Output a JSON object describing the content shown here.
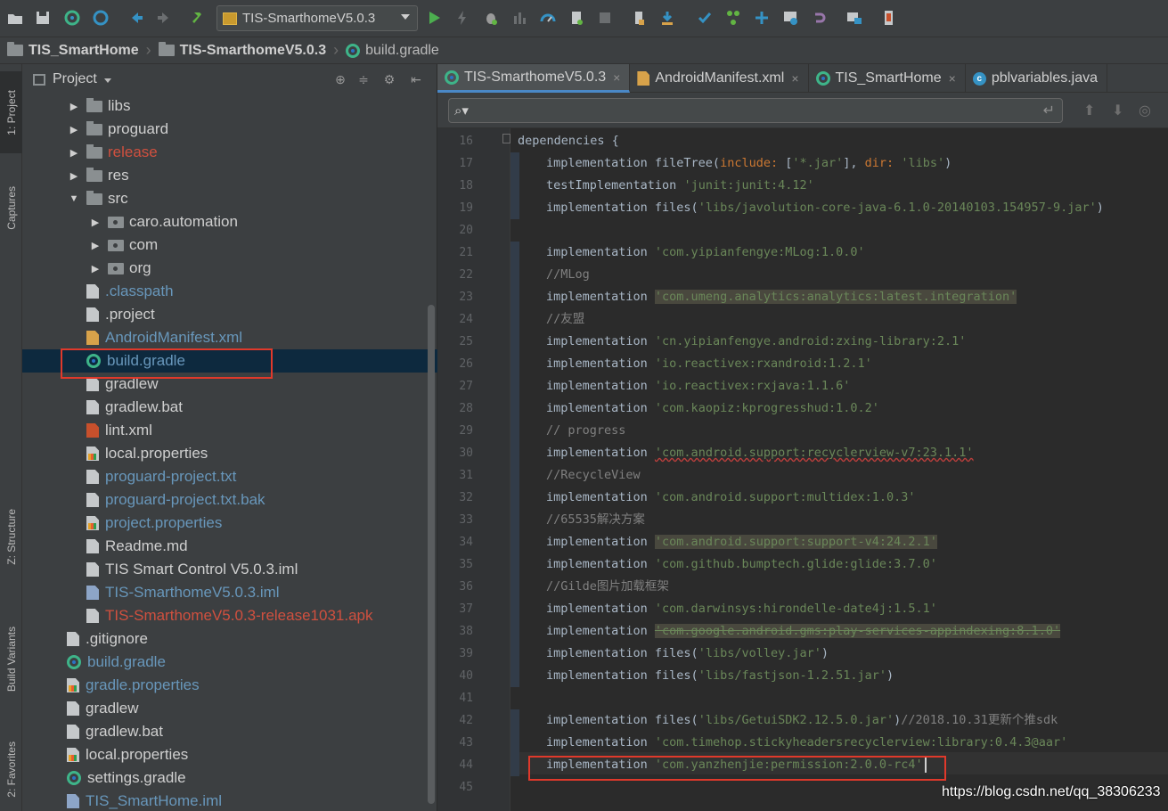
{
  "toolbar": {
    "run_config": "TIS-SmarthomeV5.0.3",
    "icons": [
      "open-icon",
      "save-icon",
      "sync-icon",
      "sync-project-icon",
      "back-icon",
      "forward-icon",
      "hammer-icon",
      "run-icon",
      "apply-changes-icon",
      "debug-icon",
      "profile-icon",
      "attach-debugger-icon",
      "stop-icon",
      "avd-manager-icon",
      "sdk-manager-icon",
      "vcs-update-icon",
      "vcs-commit-icon",
      "vcs-push-icon",
      "vcs-history-icon",
      "revert-icon",
      "project-structure-icon",
      "device-file-icon"
    ]
  },
  "breadcrumb": {
    "items": [
      "TIS_SmartHome",
      "TIS-SmarthomeV5.0.3",
      "build.gradle"
    ]
  },
  "left_strip": {
    "project": "1: Project",
    "captures": "Captures",
    "structure": "Z: Structure",
    "build_variants": "Build Variants",
    "favorites": "2: Favorites"
  },
  "project_panel": {
    "title": "Project",
    "tree": [
      {
        "label": "libs",
        "icon": "folder",
        "indent": 1,
        "arrow": "right",
        "color": "default"
      },
      {
        "label": "proguard",
        "icon": "folder",
        "indent": 1,
        "arrow": "right",
        "color": "default"
      },
      {
        "label": "release",
        "icon": "folder",
        "indent": 1,
        "arrow": "right",
        "color": "red"
      },
      {
        "label": "res",
        "icon": "folder",
        "indent": 1,
        "arrow": "right",
        "color": "default"
      },
      {
        "label": "src",
        "icon": "folder",
        "indent": 1,
        "arrow": "down",
        "color": "default"
      },
      {
        "label": "caro.automation",
        "icon": "pkg",
        "indent": 2,
        "arrow": "right",
        "color": "default"
      },
      {
        "label": "com",
        "icon": "pkg",
        "indent": 2,
        "arrow": "right",
        "color": "default"
      },
      {
        "label": "org",
        "icon": "pkg",
        "indent": 2,
        "arrow": "right",
        "color": "default"
      },
      {
        "label": ".classpath",
        "icon": "file",
        "indent": 1,
        "arrow": "",
        "color": "blue"
      },
      {
        "label": ".project",
        "icon": "file",
        "indent": 1,
        "arrow": "",
        "color": "default"
      },
      {
        "label": "AndroidManifest.xml",
        "icon": "xml",
        "indent": 1,
        "arrow": "",
        "color": "blue"
      },
      {
        "label": "build.gradle",
        "icon": "gradle",
        "indent": 1,
        "arrow": "",
        "color": "blue",
        "selected": true
      },
      {
        "label": "gradlew",
        "icon": "file",
        "indent": 1,
        "arrow": "",
        "color": "default"
      },
      {
        "label": "gradlew.bat",
        "icon": "file",
        "indent": 1,
        "arrow": "",
        "color": "default"
      },
      {
        "label": "lint.xml",
        "icon": "lint",
        "indent": 1,
        "arrow": "",
        "color": "default"
      },
      {
        "label": "local.properties",
        "icon": "prop",
        "indent": 1,
        "arrow": "",
        "color": "default"
      },
      {
        "label": "proguard-project.txt",
        "icon": "file",
        "indent": 1,
        "arrow": "",
        "color": "blue"
      },
      {
        "label": "proguard-project.txt.bak",
        "icon": "file",
        "indent": 1,
        "arrow": "",
        "color": "blue"
      },
      {
        "label": "project.properties",
        "icon": "prop",
        "indent": 1,
        "arrow": "",
        "color": "blue"
      },
      {
        "label": "Readme.md",
        "icon": "file",
        "indent": 1,
        "arrow": "",
        "color": "default"
      },
      {
        "label": "TIS Smart Control V5.0.3.iml",
        "icon": "file",
        "indent": 1,
        "arrow": "",
        "color": "default"
      },
      {
        "label": "TIS-SmarthomeV5.0.3.iml",
        "icon": "iml",
        "indent": 1,
        "arrow": "",
        "color": "blue"
      },
      {
        "label": "TIS-SmarthomeV5.0.3-release1031.apk",
        "icon": "apk",
        "indent": 1,
        "arrow": "",
        "color": "red"
      },
      {
        "label": ".gitignore",
        "icon": "file",
        "indent": 0,
        "arrow": "",
        "color": "default"
      },
      {
        "label": "build.gradle",
        "icon": "gradle",
        "indent": 0,
        "arrow": "",
        "color": "blue"
      },
      {
        "label": "gradle.properties",
        "icon": "prop",
        "indent": 0,
        "arrow": "",
        "color": "blue"
      },
      {
        "label": "gradlew",
        "icon": "file",
        "indent": 0,
        "arrow": "",
        "color": "default"
      },
      {
        "label": "gradlew.bat",
        "icon": "file",
        "indent": 0,
        "arrow": "",
        "color": "default"
      },
      {
        "label": "local.properties",
        "icon": "prop",
        "indent": 0,
        "arrow": "",
        "color": "default"
      },
      {
        "label": "settings.gradle",
        "icon": "gradle",
        "indent": 0,
        "arrow": "",
        "color": "default"
      },
      {
        "label": "TIS_SmartHome.iml",
        "icon": "iml",
        "indent": 0,
        "arrow": "",
        "color": "blue"
      }
    ]
  },
  "editor": {
    "tabs": [
      {
        "label": "TIS-SmarthomeV5.0.3",
        "icon": "gradle",
        "active": true
      },
      {
        "label": "AndroidManifest.xml",
        "icon": "xml",
        "active": false
      },
      {
        "label": "TIS_SmartHome",
        "icon": "gradle",
        "active": false
      },
      {
        "label": "pblvariables.java",
        "icon": "class",
        "active": false
      }
    ],
    "search_placeholder": "",
    "lines": [
      {
        "n": "16",
        "indent": 0,
        "parts": [
          [
            "id",
            "dependencies {"
          ]
        ]
      },
      {
        "n": "17",
        "indent": 1,
        "parts": [
          [
            "id",
            "implementation fileTree("
          ],
          [
            "kw",
            "include: "
          ],
          [
            "id",
            "["
          ],
          [
            "s",
            "'*.jar'"
          ],
          [
            "id",
            "], "
          ],
          [
            "kw",
            "dir: "
          ],
          [
            "s",
            "'libs'"
          ],
          [
            "id",
            ")"
          ]
        ]
      },
      {
        "n": "18",
        "indent": 1,
        "parts": [
          [
            "id",
            "testImplementation "
          ],
          [
            "s",
            "'junit:junit:4.12'"
          ]
        ]
      },
      {
        "n": "19",
        "indent": 1,
        "parts": [
          [
            "id",
            "implementation files("
          ],
          [
            "s",
            "'libs/javolution-core-java-6.1.0-20140103.154957-9.jar'"
          ],
          [
            "id",
            ")"
          ]
        ]
      },
      {
        "n": "20",
        "indent": 0,
        "parts": []
      },
      {
        "n": "21",
        "indent": 1,
        "parts": [
          [
            "id",
            "implementation "
          ],
          [
            "s",
            "'com.yipianfengye:MLog:1.0.0'"
          ]
        ]
      },
      {
        "n": "22",
        "indent": 1,
        "parts": [
          [
            "cm",
            "//MLog"
          ]
        ]
      },
      {
        "n": "23",
        "indent": 1,
        "parts": [
          [
            "id",
            "implementation "
          ],
          [
            "s hl",
            "'com.umeng.analytics:analytics:latest.integration'"
          ]
        ]
      },
      {
        "n": "24",
        "indent": 1,
        "parts": [
          [
            "cm",
            "//友盟"
          ]
        ]
      },
      {
        "n": "25",
        "indent": 1,
        "parts": [
          [
            "id",
            "implementation "
          ],
          [
            "s",
            "'cn.yipianfengye.android:zxing-library:2.1'"
          ]
        ]
      },
      {
        "n": "26",
        "indent": 1,
        "parts": [
          [
            "id",
            "implementation "
          ],
          [
            "s",
            "'io.reactivex:rxandroid:1.2.1'"
          ]
        ]
      },
      {
        "n": "27",
        "indent": 1,
        "parts": [
          [
            "id",
            "implementation "
          ],
          [
            "s",
            "'io.reactivex:rxjava:1.1.6'"
          ]
        ]
      },
      {
        "n": "28",
        "indent": 1,
        "parts": [
          [
            "id",
            "implementation "
          ],
          [
            "s",
            "'com.kaopiz:kprogresshud:1.0.2'"
          ]
        ]
      },
      {
        "n": "29",
        "indent": 1,
        "parts": [
          [
            "cm",
            "// progress"
          ]
        ]
      },
      {
        "n": "30",
        "indent": 1,
        "parts": [
          [
            "id",
            "implementation "
          ],
          [
            "s warn",
            "'com.android.support:recyclerview-v7:23.1.1'"
          ]
        ]
      },
      {
        "n": "31",
        "indent": 1,
        "parts": [
          [
            "cm",
            "//RecycleView"
          ]
        ]
      },
      {
        "n": "32",
        "indent": 1,
        "parts": [
          [
            "id",
            "implementation "
          ],
          [
            "s",
            "'com.android.support:multidex:1.0.3'"
          ]
        ]
      },
      {
        "n": "33",
        "indent": 1,
        "parts": [
          [
            "cm",
            "//65535解决方案"
          ]
        ]
      },
      {
        "n": "34",
        "indent": 1,
        "parts": [
          [
            "id",
            "implementation "
          ],
          [
            "s hl",
            "'com.android.support:support-v4:24.2.1'"
          ]
        ]
      },
      {
        "n": "35",
        "indent": 1,
        "parts": [
          [
            "id",
            "implementation "
          ],
          [
            "s",
            "'com.github.bumptech.glide:glide:3.7.0'"
          ]
        ]
      },
      {
        "n": "36",
        "indent": 1,
        "parts": [
          [
            "cm",
            "//Gilde图片加载框架"
          ]
        ]
      },
      {
        "n": "37",
        "indent": 1,
        "parts": [
          [
            "id",
            "implementation "
          ],
          [
            "s",
            "'com.darwinsys:hirondelle-date4j:1.5.1'"
          ]
        ]
      },
      {
        "n": "38",
        "indent": 1,
        "parts": [
          [
            "id",
            "implementation "
          ],
          [
            "s hl strike",
            "'com.google.android.gms:play-services-appindexing:8.1.0'"
          ]
        ]
      },
      {
        "n": "39",
        "indent": 1,
        "parts": [
          [
            "id",
            "implementation files("
          ],
          [
            "s",
            "'libs/volley.jar'"
          ],
          [
            "id",
            ")"
          ]
        ]
      },
      {
        "n": "40",
        "indent": 1,
        "parts": [
          [
            "id",
            "implementation files("
          ],
          [
            "s",
            "'libs/fastjson-1.2.51.jar'"
          ],
          [
            "id",
            ")"
          ]
        ]
      },
      {
        "n": "41",
        "indent": 0,
        "parts": []
      },
      {
        "n": "42",
        "indent": 1,
        "parts": [
          [
            "id",
            "implementation files("
          ],
          [
            "s",
            "'libs/GetuiSDK2.12.5.0.jar'"
          ],
          [
            "id",
            ")"
          ],
          [
            "cm",
            "//2018.10.31更新个推sdk"
          ]
        ]
      },
      {
        "n": "43",
        "indent": 1,
        "parts": [
          [
            "id",
            "implementation "
          ],
          [
            "s",
            "'com.timehop.stickyheadersrecyclerview:library:0.4.3@aar'"
          ]
        ]
      },
      {
        "n": "44",
        "indent": 1,
        "parts": [
          [
            "id",
            "implementation "
          ],
          [
            "s",
            "'com.yanzhenjie:permission:2.0.0-rc4'"
          ]
        ]
      },
      {
        "n": "45",
        "indent": 0,
        "parts": []
      }
    ]
  },
  "watermark": "https://blog.csdn.net/qq_38306233",
  "colors": {
    "accent": "#4a88c7",
    "highlight_box": "#e0392b",
    "selection": "#0d293e"
  }
}
